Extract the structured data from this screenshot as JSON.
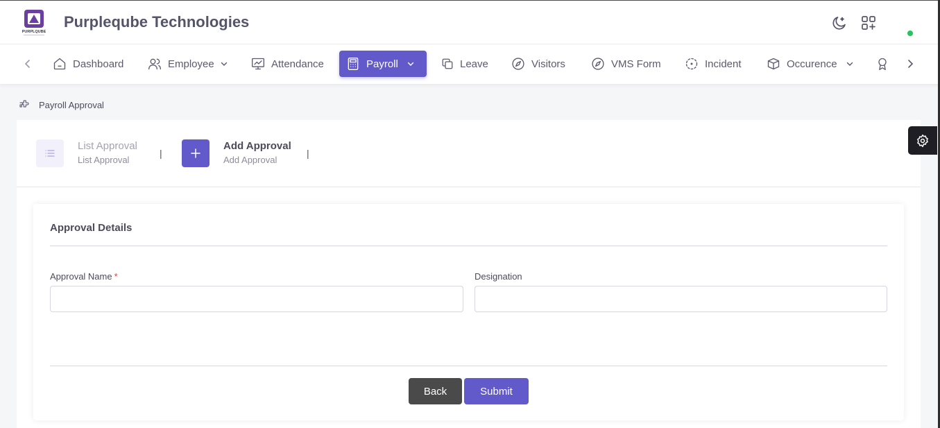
{
  "header": {
    "company_name": "Purpleqube Technologies",
    "logo_text": "PURPLQUBE",
    "icons": [
      "moon-icon",
      "apps-add-icon"
    ],
    "status_color": "#22c55e"
  },
  "nav": {
    "items": [
      {
        "label": "Dashboard",
        "icon": "home-icon"
      },
      {
        "label": "Employee",
        "icon": "users-icon",
        "dropdown": true
      },
      {
        "label": "Attendance",
        "icon": "presentation-icon"
      },
      {
        "label": "Payroll",
        "icon": "calculator-icon",
        "dropdown": true,
        "active": true
      },
      {
        "label": "Leave",
        "icon": "copy-icon"
      },
      {
        "label": "Visitors",
        "icon": "compass-icon"
      },
      {
        "label": "VMS Form",
        "icon": "compass-icon"
      },
      {
        "label": "Incident",
        "icon": "focus-icon"
      },
      {
        "label": "Occurence",
        "icon": "box-icon",
        "dropdown": true
      },
      {
        "label": "",
        "icon": "award-icon"
      }
    ],
    "accent": "#6259ca"
  },
  "breadcrumb": {
    "label": "Payroll Approval"
  },
  "tabs": [
    {
      "title": "List Approval",
      "subtitle": "List Approval",
      "icon": "list-icon",
      "active": false
    },
    {
      "title": "Add Approval",
      "subtitle": "Add Approval",
      "icon": "plus-icon",
      "active": true
    }
  ],
  "form": {
    "title": "Approval Details",
    "fields": {
      "approval_name": {
        "label": "Approval Name",
        "required_mark": "*",
        "value": ""
      },
      "designation": {
        "label": "Designation",
        "value": ""
      }
    },
    "back_label": "Back",
    "submit_label": "Submit"
  }
}
